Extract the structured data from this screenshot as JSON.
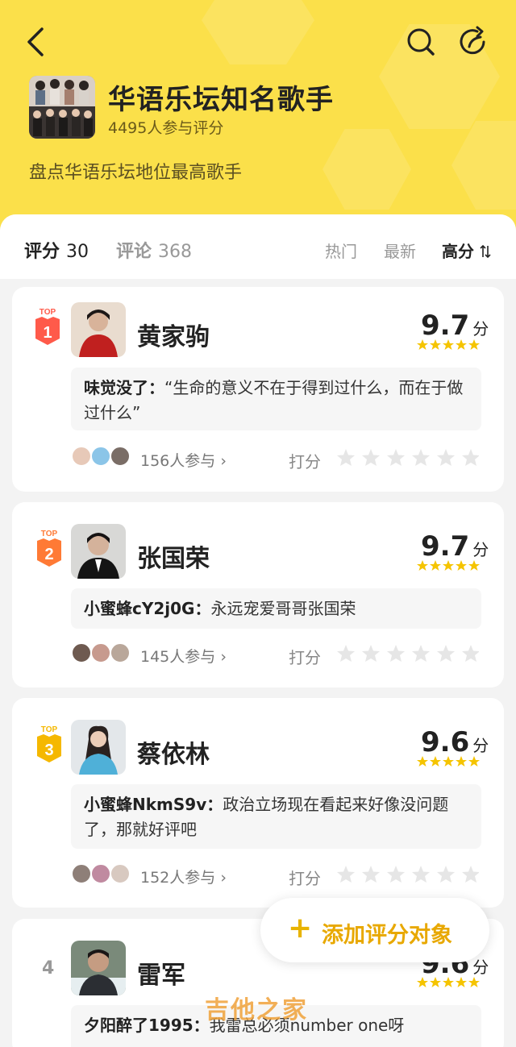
{
  "header": {
    "title": "华语乐坛知名歌手",
    "participants": "4495人参与评分",
    "description": "盘点华语乐坛地位最高歌手"
  },
  "tabs": {
    "rating_label": "评分",
    "rating_count": "30",
    "comment_label": "评论",
    "comment_count": "368"
  },
  "sort": {
    "hot": "热门",
    "latest": "最新",
    "high": "高分"
  },
  "items": [
    {
      "rank_badge": "TOP",
      "rank": "1",
      "name": "黄家驹",
      "score": "9.7",
      "unit": "分",
      "rating_stars": 5,
      "comment_user": "味觉没了：",
      "comment_text": "“生命的意义不在于得到过什么，而在于做过什么”",
      "participants": "156人参与",
      "rate_label": "打分",
      "badge_color": "#ff5a4a"
    },
    {
      "rank_badge": "TOP",
      "rank": "2",
      "name": "张国荣",
      "score": "9.7",
      "unit": "分",
      "rating_stars": 5,
      "comment_user": "小蜜蜂cY2j0G：",
      "comment_text": "永远宠爱哥哥张国荣",
      "participants": "145人参与",
      "rate_label": "打分",
      "badge_color": "#ff7a35"
    },
    {
      "rank_badge": "TOP",
      "rank": "3",
      "name": "蔡依林",
      "score": "9.6",
      "unit": "分",
      "rating_stars": 5,
      "comment_user": "小蜜蜂NkmS9v：",
      "comment_text": "政治立场现在看起来好像没问题了，那就好评吧",
      "participants": "152人参与",
      "rate_label": "打分",
      "badge_color": "#f5b800"
    },
    {
      "rank": "4",
      "name": "雷军",
      "score": "9.6",
      "unit": "分",
      "rating_stars": 5,
      "comment_user": "夕阳醉了1995：",
      "comment_text": "我雷总必须number one呀"
    }
  ],
  "fab": {
    "icon": "plus-icon",
    "label": "添加评分对象"
  },
  "watermark": "吉他之家",
  "colors": {
    "header": "#fbe04a",
    "accent": "#e8b300",
    "star": "#f5c400",
    "star_empty": "#e6e6e6"
  }
}
